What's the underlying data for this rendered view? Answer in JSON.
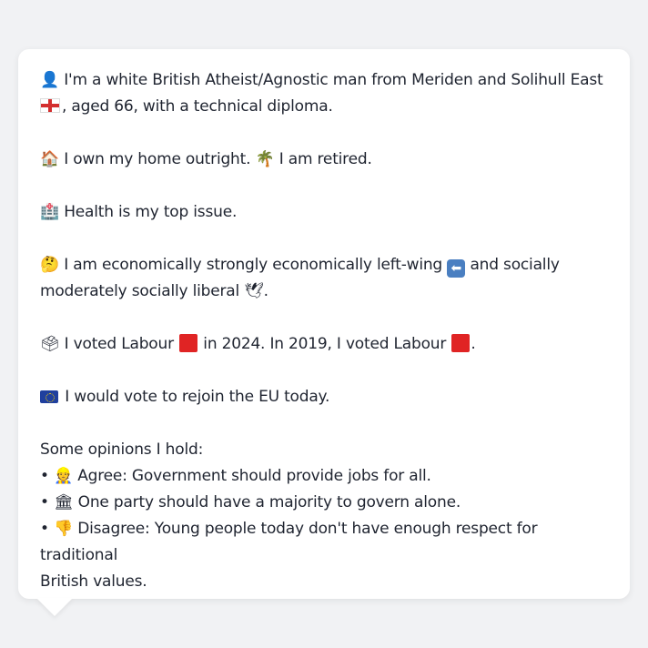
{
  "colors": {
    "background": "#f1f2f4",
    "card": "#ffffff",
    "text": "#1f2430",
    "labour_red": "#e02424",
    "eu_blue": "#1f3f9e",
    "left_arrow_box": "#4a7fc1"
  },
  "icons": {
    "person": "👤",
    "england_flag": "england-flag",
    "house": "🏠",
    "palm": "🌴",
    "hospital": "🏥",
    "thinking": "🤔",
    "left_arrow": "⬅",
    "dove": "🕊",
    "ballot": "🗳",
    "eu_flag": "eu-flag",
    "worker": "👷",
    "government": "🏛",
    "thumbs_down": "👎",
    "bullet": "•"
  },
  "profile": {
    "line1": "I'm a white British Atheist/Agnostic man from Meriden and Solihull East",
    "line1b": ", aged 66, with a technical diploma.",
    "home_a": "I own my home outright.",
    "home_b": "I am retired.",
    "health": "Health is my top issue.",
    "econ_a": "I am economically strongly economically left-wing",
    "econ_b": "and socially",
    "econ_c": "moderately socially liberal",
    "econ_end": ".",
    "vote_a": "I voted Labour",
    "vote_b": "in 2024. In 2019, I voted Labour",
    "vote_end": ".",
    "eu": "I would vote to rejoin the EU today."
  },
  "opinions": {
    "heading": "Some opinions I hold:",
    "items": [
      "Agree: Government should provide jobs for all.",
      "One party should have a majority to govern alone.",
      "Disagree: Young people today don't have enough respect for traditional",
      "British values."
    ]
  }
}
